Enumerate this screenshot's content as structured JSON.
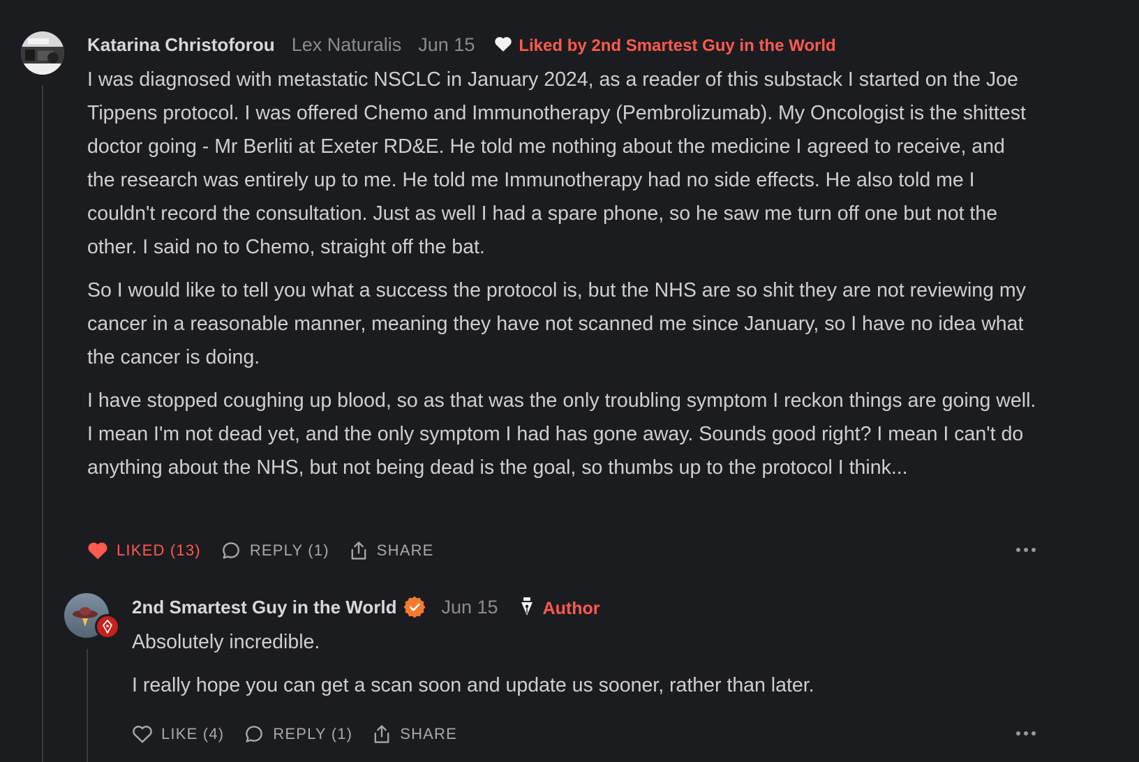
{
  "comment": {
    "author": "Katarina Christoforou",
    "publication": "Lex Naturalis",
    "date": "Jun 15",
    "liked_by": "Liked by 2nd Smartest Guy in the World",
    "paragraphs": [
      "I was diagnosed with metastatic NSCLC in January 2024, as a reader of this substack I started on the Joe Tippens protocol. I was offered Chemo and Immunotherapy (Pembrolizumab). My Oncologist is the shittest doctor going - Mr Berliti at Exeter RD&E. He told me nothing about the medicine I agreed to receive, and the research was entirely up to me. He told me Immunotherapy had no side effects. He also told me I couldn't record the consultation. Just as well I had a spare phone, so he saw me turn off one but not the other. I said no to Chemo, straight off the bat.",
      "So I would like to tell you what a success the protocol is, but the NHS are so shit they are not reviewing my cancer in a reasonable manner, meaning they have not scanned me since January, so I have no idea what the cancer is doing.",
      "I have stopped coughing up blood, so as that was the only troubling symptom I reckon things are going well. I mean I'm not dead yet, and the only symptom I had has gone away. Sounds good right? I mean I can't do anything about the NHS, but not being dead is the goal, so thumbs up to the protocol I think..."
    ],
    "actions": {
      "like": "LIKED (13)",
      "reply": "REPLY (1)",
      "share": "SHARE"
    }
  },
  "reply": {
    "author": "2nd Smartest Guy in the World",
    "date": "Jun 15",
    "author_badge": "Author",
    "paragraphs": [
      "Absolutely incredible.",
      "I really hope you can get a scan soon and update us sooner, rather than later."
    ],
    "actions": {
      "like": "LIKE (4)",
      "reply": "REPLY (1)",
      "share": "SHARE"
    }
  },
  "colors": {
    "background": "#1b1c1f",
    "accent": "#ff5a4f",
    "verified": "#f47a30",
    "text": "#cfcfcf",
    "muted": "#8c8c8c"
  }
}
